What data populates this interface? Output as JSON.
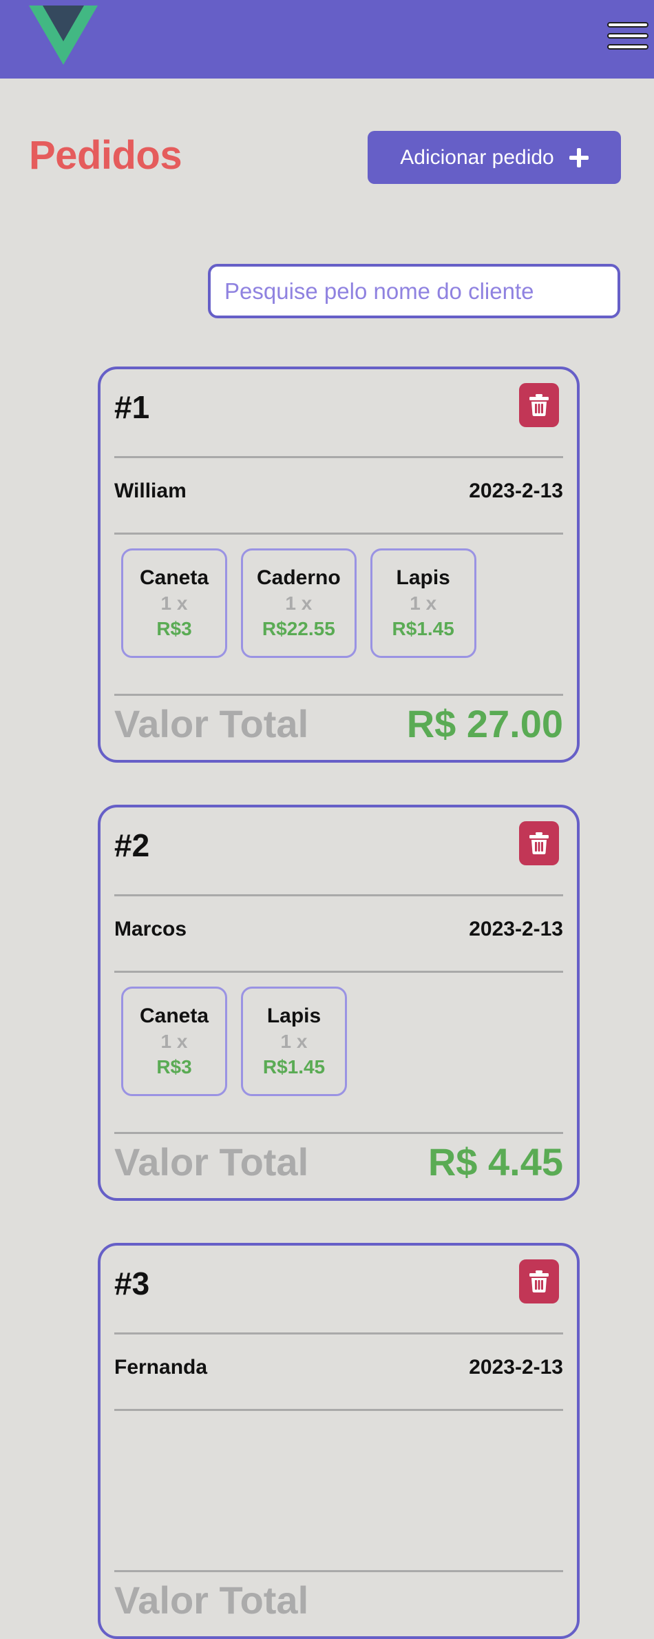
{
  "header": {
    "logo": "vue-logo",
    "menu_icon": "hamburger-menu-icon"
  },
  "page": {
    "title": "Pedidos",
    "add_button_label": "Adicionar pedido",
    "add_button_icon": "plus-icon"
  },
  "search": {
    "placeholder": "Pesquise pelo nome do cliente",
    "value": ""
  },
  "colors": {
    "brand": "#665fc7",
    "title": "#e55c5c",
    "delete": "#c23656",
    "price": "#5aab54",
    "muted": "#ababab"
  },
  "orders": [
    {
      "number": "#1",
      "customer": "William",
      "date": "2023-2-13",
      "items": [
        {
          "name": "Caneta",
          "qty": "1 x",
          "price": "R$3"
        },
        {
          "name": "Caderno",
          "qty": "1 x",
          "price": "R$22.55"
        },
        {
          "name": "Lapis",
          "qty": "1 x",
          "price": "R$1.45"
        }
      ],
      "total_label": "Valor Total",
      "total_value": "R$ 27.00"
    },
    {
      "number": "#2",
      "customer": "Marcos",
      "date": "2023-2-13",
      "items": [
        {
          "name": "Caneta",
          "qty": "1 x",
          "price": "R$3"
        },
        {
          "name": "Lapis",
          "qty": "1 x",
          "price": "R$1.45"
        }
      ],
      "total_label": "Valor Total",
      "total_value": "R$ 4.45"
    },
    {
      "number": "#3",
      "customer": "Fernanda",
      "date": "2023-2-13",
      "items": [],
      "total_label": "Valor Total",
      "total_value": ""
    }
  ]
}
